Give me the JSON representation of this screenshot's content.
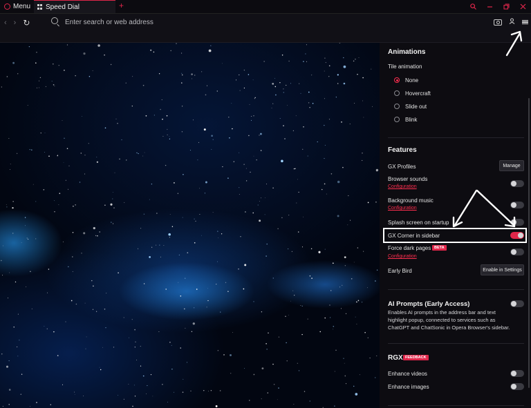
{
  "browser": {
    "menu_label": "Menu",
    "tab_title": "Speed Dial",
    "new_tab": "+",
    "address_placeholder": "Enter search or web address"
  },
  "icons": {
    "logo": "opera-logo-icon",
    "tab": "speed-dial-grid-icon",
    "back": "arrow-left-icon",
    "forward": "arrow-right-icon",
    "reload": "reload-icon",
    "search": "search-icon",
    "snapshot": "camera-icon",
    "profile": "profile-icon",
    "easy_setup": "menu-icon"
  },
  "colors": {
    "accent": "#e0264a",
    "link": "#ff2e4f",
    "panel_bg": "#0d0c11"
  },
  "settings": {
    "animations": {
      "title": "Animations",
      "tile_animation_label": "Tile animation",
      "options": [
        {
          "label": "None",
          "selected": true
        },
        {
          "label": "Hovercraft",
          "selected": false
        },
        {
          "label": "Slide out",
          "selected": false
        },
        {
          "label": "Blink",
          "selected": false
        }
      ]
    },
    "features": {
      "title": "Features",
      "gx_profiles": "GX Profiles",
      "manage": "Manage",
      "browser_sounds": "Browser sounds",
      "browser_sounds_link": "Configuration",
      "background_music": "Background music",
      "background_music_link": "Configuration",
      "splash_screen": "Splash screen on startup",
      "gx_corner": "GX Corner in sidebar",
      "force_dark": "Force dark pages",
      "force_dark_badge": "BETA",
      "force_dark_link": "Configuration",
      "early_bird": "Early Bird",
      "enable_in_settings": "Enable in Settings"
    },
    "ai_prompts": {
      "title": "AI Prompts (Early Access)",
      "description": "Enables AI prompts in the address bar and text highlight popup, connected to services such as ChatGPT and ChatSonic in Opera Browser's sidebar."
    },
    "rgx": {
      "title": "RGX",
      "badge": "FEEDBACK",
      "enhance_videos": "Enhance videos",
      "enhance_images": "Enhance images"
    }
  }
}
